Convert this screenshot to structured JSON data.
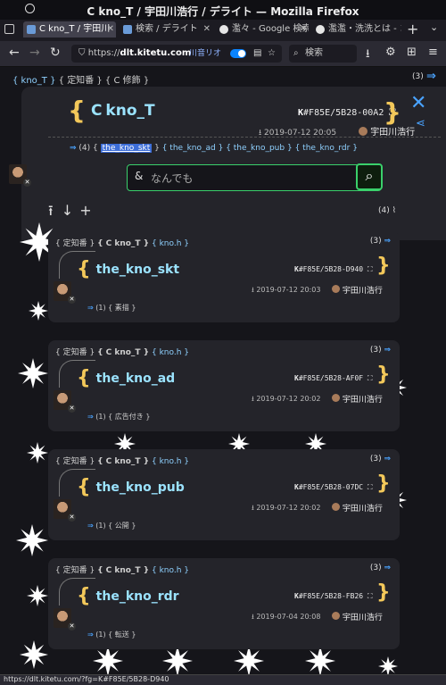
{
  "window": {
    "title": "C kno_T / 宇田川浩行 / デライト — Mozilla Firefox",
    "ghost_title": "Mozilla Firefox"
  },
  "tabs": [
    {
      "label": "C kno_T / 宇田川",
      "color": "#6a9bd8"
    },
    {
      "label": "検索 / デライト",
      "color": "#6a9bd8"
    },
    {
      "label": "濫々 - Google 検索",
      "color": "#e6e6e6"
    },
    {
      "label": "濫濫・洗洗とは - コ",
      "color": "#e6e6e6"
    }
  ],
  "nav": {
    "url_prefix": "https://",
    "url_host": "dlt.kitetu.com",
    "ext_label": "川音リオ",
    "search_placeholder": "検索"
  },
  "crumbs": [
    "kno_T",
    "定知番",
    "C 修飾"
  ],
  "crumbs_count": "(3)",
  "hero": {
    "title_prefix": "C",
    "title": "kno_T",
    "k_label": "K",
    "k_value": "#F85E/5B28-00A2",
    "date": "2019-07-12 20:05",
    "author": "宇田川浩行",
    "children_count": "(4)",
    "children": [
      "the_kno_skt",
      "the_kno_ad",
      "the_kno_pub",
      "the_kno_rdr"
    ],
    "search_placeholder": "なんでも",
    "search_symbol": "&"
  },
  "list_count": "(4)",
  "cards": [
    {
      "crumbs": [
        "定知番",
        "C kno_T",
        "kno.h"
      ],
      "count": "(3)",
      "title": "the_kno_skt",
      "k": "#F85E/5B28-D940",
      "date": "2019-07-12 20:03",
      "author": "宇田川浩行",
      "tag_count": "(1)",
      "tag": "素描"
    },
    {
      "crumbs": [
        "定知番",
        "C kno_T",
        "kno.h"
      ],
      "count": "(3)",
      "title": "the_kno_ad",
      "k": "#F85E/5B28-AF0F",
      "date": "2019-07-12 20:02",
      "author": "宇田川浩行",
      "tag_count": "(1)",
      "tag": "広告付き"
    },
    {
      "crumbs": [
        "定知番",
        "C kno_T",
        "kno.h"
      ],
      "count": "(3)",
      "title": "the_kno_pub",
      "k": "#F85E/5B28-07DC",
      "date": "2019-07-12 20:02",
      "author": "宇田川浩行",
      "tag_count": "(1)",
      "tag": "公開"
    },
    {
      "crumbs": [
        "定知番",
        "C kno_T",
        "kno.h"
      ],
      "count": "(3)",
      "title": "the_kno_rdr",
      "k": "#F85E/5B28-FB26",
      "date": "2019-07-04 20:08",
      "author": "宇田川浩行",
      "tag_count": "(1)",
      "tag": "転送"
    }
  ],
  "status_url": "https://dlt.kitetu.com/?fg=K#F85E/5B28-D940"
}
